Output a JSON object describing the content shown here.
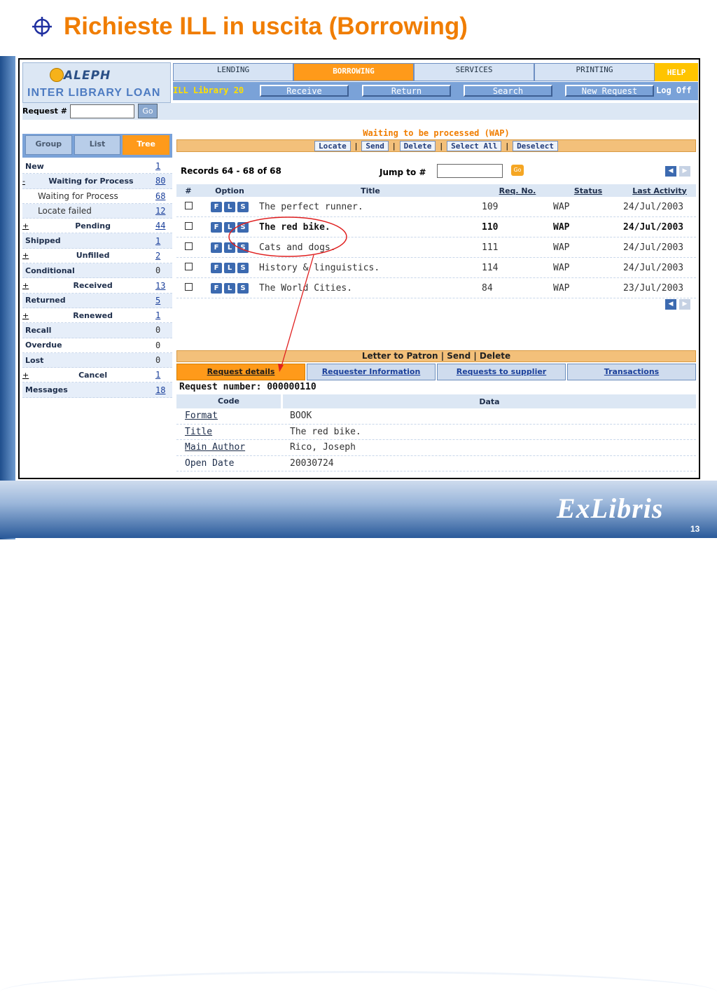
{
  "slide": {
    "title": "Richieste ILL in uscita (Borrowing)",
    "brand": "ExLibris",
    "page_number": "13"
  },
  "app": {
    "logo_name": "ALEPH",
    "logo_subtitle": "INTER LIBRARY LOAN",
    "library_label": "ILL Library 20",
    "logoff": "Log Off",
    "help": "HELP"
  },
  "topnav": [
    "LENDING",
    "BORROWING",
    "SERVICES",
    "PRINTING"
  ],
  "subnav": [
    "Receive",
    "Return",
    "Search",
    "New Request"
  ],
  "request_search": {
    "label": "Request #",
    "value": "",
    "go": "Go"
  },
  "side_tabs": [
    "Group",
    "List",
    "Tree"
  ],
  "tree": [
    {
      "label": "New",
      "count": "1",
      "prefix": "",
      "sub": false,
      "link": true
    },
    {
      "label": "Waiting for Process",
      "count": "80",
      "prefix": "-",
      "sub": false,
      "link": true
    },
    {
      "label": "Waiting for Process",
      "count": "68",
      "prefix": "",
      "sub": true,
      "link": true
    },
    {
      "label": "Locate failed",
      "count": "12",
      "prefix": "",
      "sub": true,
      "link": true
    },
    {
      "label": "Pending",
      "count": "44",
      "prefix": "+",
      "sub": false,
      "link": true
    },
    {
      "label": "Shipped",
      "count": "1",
      "prefix": "",
      "sub": false,
      "link": true
    },
    {
      "label": "Unfilled",
      "count": "2",
      "prefix": "+",
      "sub": false,
      "link": true
    },
    {
      "label": "Conditional",
      "count": "0",
      "prefix": "",
      "sub": false,
      "link": false
    },
    {
      "label": "Received",
      "count": "13",
      "prefix": "+",
      "sub": false,
      "link": true
    },
    {
      "label": "Returned",
      "count": "5",
      "prefix": "",
      "sub": false,
      "link": true
    },
    {
      "label": "Renewed",
      "count": "1",
      "prefix": "+",
      "sub": false,
      "link": true
    },
    {
      "label": "Recall",
      "count": "0",
      "prefix": "",
      "sub": false,
      "link": false
    },
    {
      "label": "Overdue",
      "count": "0",
      "prefix": "",
      "sub": false,
      "link": false
    },
    {
      "label": "Lost",
      "count": "0",
      "prefix": "",
      "sub": false,
      "link": false
    },
    {
      "label": "Cancel",
      "count": "1",
      "prefix": "+",
      "sub": false,
      "link": true
    },
    {
      "label": "Messages",
      "count": "18",
      "prefix": "",
      "sub": false,
      "link": true
    }
  ],
  "list": {
    "title": "Waiting to be processed (WAP)",
    "actions": [
      "Locate",
      "Send",
      "Delete",
      "Select All",
      "Deselect"
    ],
    "records_text": "Records 64 - 68 of 68",
    "jump_label": "Jump to #",
    "jump_value": "",
    "go": "Go",
    "columns": [
      "#",
      "Option",
      "Title",
      "Req. No.",
      "Status",
      "Last Activity"
    ],
    "option_buttons": [
      "F",
      "L",
      "S"
    ],
    "rows": [
      {
        "title": "The perfect runner.",
        "req_no": "109",
        "status": "WAP",
        "last_activity": "24/Jul/2003",
        "selected": false
      },
      {
        "title": "The red bike.",
        "req_no": "110",
        "status": "WAP",
        "last_activity": "24/Jul/2003",
        "selected": true
      },
      {
        "title": "Cats and dogs.",
        "req_no": "111",
        "status": "WAP",
        "last_activity": "24/Jul/2003",
        "selected": false
      },
      {
        "title": "History & linguistics.",
        "req_no": "114",
        "status": "WAP",
        "last_activity": "24/Jul/2003",
        "selected": false
      },
      {
        "title": "The World Cities.",
        "req_no": "84",
        "status": "WAP",
        "last_activity": "23/Jul/2003",
        "selected": false
      }
    ]
  },
  "detail": {
    "letter_bar": "Letter to Patron | Send | Delete",
    "tabs": [
      "Request details",
      "Requester Information",
      "Requests to supplier",
      "Transactions"
    ],
    "request_number": "Request number: 000000110",
    "columns": [
      "Code",
      "Data"
    ],
    "rows": [
      {
        "code": "Format",
        "data": "BOOK",
        "link": true
      },
      {
        "code": "Title",
        "data": "The red bike.",
        "link": true
      },
      {
        "code": "Main Author",
        "data": "Rico, Joseph",
        "link": true
      },
      {
        "code": "Open Date",
        "data": "20030724",
        "link": false
      }
    ]
  },
  "colors": {
    "accent": "#f07d00",
    "nav_blue": "#7aa2d8",
    "annotation": "#e02020"
  }
}
